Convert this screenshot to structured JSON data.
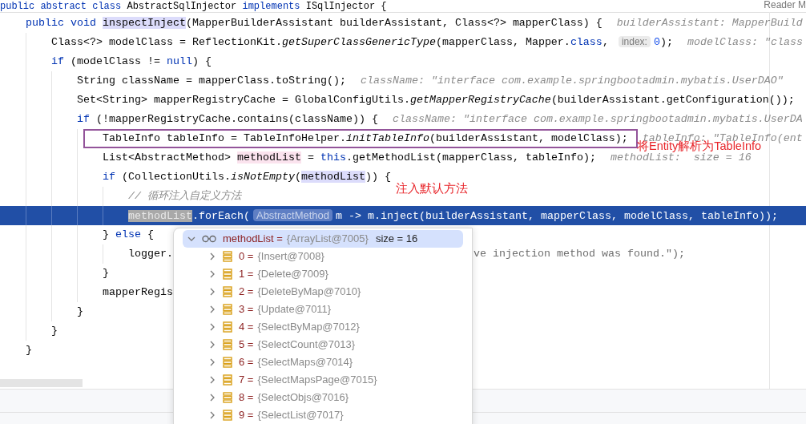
{
  "reader_mode": "Reader M",
  "lines": [
    {
      "code": [
        {
          "text": "public abstract class ",
          "kind": "kw"
        },
        {
          "text": "AbstractSqlInjector ",
          "kind": "plain"
        },
        {
          "text": "implements ",
          "kind": "kw"
        },
        {
          "text": "ISqlInjector {",
          "kind": "plain"
        }
      ]
    },
    {
      "code": [
        {
          "text": "    public void ",
          "kind": "kw"
        },
        {
          "text": "inspectInject",
          "kind": "usage"
        },
        {
          "text": "(MapperBuilderAssistant builderAssistant, Class<?> mapperClass) {",
          "kind": "plain"
        }
      ],
      "hint": "builderAssistant: MapperBuild"
    },
    {
      "code": [
        {
          "text": "        Class<?> modelClass = ReflectionKit.",
          "kind": "plain"
        },
        {
          "text": "getSuperClassGenericType",
          "kind": "static"
        },
        {
          "text": "(mapperClass, Mapper.",
          "kind": "plain"
        },
        {
          "text": "class",
          "kind": "kw"
        },
        {
          "text": ", ",
          "kind": "plain"
        },
        {
          "text": "index:",
          "kind": "inlay"
        },
        {
          "text": "0",
          "kind": "num"
        },
        {
          "text": ");",
          "kind": "plain"
        }
      ],
      "hint": "modelClass: \"class"
    },
    {
      "code": [
        {
          "text": "        if ",
          "kind": "kw"
        },
        {
          "text": "(modelClass != ",
          "kind": "plain"
        },
        {
          "text": "null",
          "kind": "kw"
        },
        {
          "text": ") {",
          "kind": "plain"
        }
      ]
    },
    {
      "code": [
        {
          "text": "            String className = mapperClass.toString();",
          "kind": "plain"
        }
      ],
      "hint": "className: \"interface com.example.springbootadmin.mybatis.UserDAO\""
    },
    {
      "code": [
        {
          "text": "            Set<String> mapperRegistryCache = GlobalConfigUtils.",
          "kind": "plain"
        },
        {
          "text": "getMapperRegistryCache",
          "kind": "static"
        },
        {
          "text": "(builderAssistant.getConfiguration());",
          "kind": "plain"
        }
      ]
    },
    {
      "code": [
        {
          "text": "            if ",
          "kind": "kw"
        },
        {
          "text": "(!mapperRegistryCache.contains(className)) {",
          "kind": "plain"
        }
      ],
      "hint": "className: \"interface com.example.springbootadmin.mybatis.UserDA"
    },
    {
      "code": [
        {
          "text": "                TableInfo tableInfo = TableInfoHelper.",
          "kind": "plain"
        },
        {
          "text": "initTableInfo",
          "kind": "static"
        },
        {
          "text": "(builderAssistant, modelClass);",
          "kind": "plain"
        }
      ],
      "hint": "tableInfo: \"TableInfo(ent",
      "boxed": true,
      "note": "将Entity解析为TableInfo"
    },
    {
      "code": [
        {
          "text": "                List<AbstractMethod> ",
          "kind": "plain"
        },
        {
          "text": "methodList",
          "kind": "write"
        },
        {
          "text": " = ",
          "kind": "plain"
        },
        {
          "text": "this",
          "kind": "kw"
        },
        {
          "text": ".getMethodList(mapperClass, tableInfo);",
          "kind": "plain"
        }
      ],
      "hint": "methodList:  size = 16"
    },
    {
      "code": [
        {
          "text": "                if ",
          "kind": "kw"
        },
        {
          "text": "(CollectionUtils.",
          "kind": "plain"
        },
        {
          "text": "isNotEmpty",
          "kind": "static"
        },
        {
          "text": "(",
          "kind": "plain"
        },
        {
          "text": "methodList",
          "kind": "usage"
        },
        {
          "text": ")) {",
          "kind": "plain"
        }
      ]
    },
    {
      "code": [
        {
          "text": "                    // 循环注入自定义方法",
          "kind": "comment"
        }
      ],
      "note": "注入默认方法"
    },
    {
      "code": [
        {
          "text": "                    methodList",
          "kind": "selected"
        },
        {
          "text": ".forEach(",
          "kind": "plain"
        },
        {
          "text": "AbstractMethod",
          "kind": "inlay"
        },
        {
          "text": "m -> m.inject(builderAssistant, mapperClass, modelClass, tableInfo));",
          "kind": "plain"
        }
      ],
      "current": true
    },
    {
      "code": [
        {
          "text": "                } ",
          "kind": "plain"
        },
        {
          "text": "else",
          "kind": "kw"
        },
        {
          "text": " {",
          "kind": "plain"
        }
      ]
    },
    {
      "code": [
        {
          "text": "                    logger.",
          "kind": "plain"
        }
      ],
      "after_popup": "ve injection method was found.\");"
    },
    {
      "code": [
        {
          "text": "                }",
          "kind": "plain"
        }
      ]
    },
    {
      "code": [
        {
          "text": "                mapperRegis",
          "kind": "plain"
        }
      ]
    },
    {
      "code": [
        {
          "text": "            }",
          "kind": "plain"
        }
      ]
    },
    {
      "code": [
        {
          "text": "        }",
          "kind": "plain"
        }
      ]
    },
    {
      "code": [
        {
          "text": "    }",
          "kind": "plain"
        }
      ]
    }
  ],
  "debug_popup": {
    "name": "methodList =",
    "value": "{ArrayList@7005}",
    "size": "size = 16",
    "expanded": true,
    "selected": true,
    "children": [
      {
        "name": "0 =",
        "value": "{Insert@7008}",
        "expanded": false,
        "selected": false
      },
      {
        "name": "1 =",
        "value": "{Delete@7009}",
        "expanded": false,
        "selected": false
      },
      {
        "name": "2 =",
        "value": "{DeleteByMap@7010}",
        "expanded": false,
        "selected": false
      },
      {
        "name": "3 =",
        "value": "{Update@7011}",
        "expanded": false,
        "selected": false
      },
      {
        "name": "4 =",
        "value": "{SelectByMap@7012}",
        "expanded": false,
        "selected": false
      },
      {
        "name": "5 =",
        "value": "{SelectCount@7013}",
        "expanded": false,
        "selected": false
      },
      {
        "name": "6 =",
        "value": "{SelectMaps@7014}",
        "expanded": false,
        "selected": false
      },
      {
        "name": "7 =",
        "value": "{SelectMapsPage@7015}",
        "expanded": false,
        "selected": false
      },
      {
        "name": "8 =",
        "value": "{SelectObjs@7016}",
        "expanded": false,
        "selected": false
      },
      {
        "name": "9 =",
        "value": "{SelectList@7017}",
        "expanded": false,
        "selected": false
      }
    ]
  }
}
